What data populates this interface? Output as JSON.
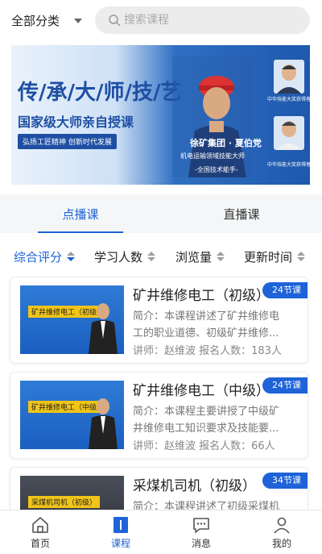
{
  "header": {
    "category_label": "全部分类",
    "search_placeholder": "搜索课程"
  },
  "banner": {
    "title": "传/承/大/师/技/艺",
    "subtitle": "国家级大师亲自授课",
    "tag": "弘扬工匠精神 创新时代发展",
    "name": "徐矿集团 · 夏伯党",
    "role": "机电运输领域技能大师",
    "honor": "-全国技术能手-",
    "portrait1_caption": "中华技能大奖获得者",
    "portrait2_caption": "中华技能大奖获得者"
  },
  "tabs": [
    {
      "label": "点播课",
      "active": true
    },
    {
      "label": "直播课",
      "active": false
    }
  ],
  "sort": [
    {
      "label": "综合评分",
      "active": true
    },
    {
      "label": "学习人数",
      "active": false
    },
    {
      "label": "浏览量",
      "active": false
    },
    {
      "label": "更新时间",
      "active": false
    }
  ],
  "courses": [
    {
      "title": "矿井维修电工（初级）",
      "thumb_text": "矿井维修电工（初级）",
      "desc": "简介：本课程讲述了矿井维修电工的职业道德、初级矿井维修...",
      "meta": "讲师：赵维波 报名人数：183人",
      "badge": "24节课"
    },
    {
      "title": "矿井维修电工（中级）",
      "thumb_text": "矿井维修电工（中级）",
      "desc": "简介：本课程主要讲授了中级矿井维修电工知识要求及技能要...",
      "meta": "讲师：赵维波 报名人数：66人",
      "badge": "24节课"
    },
    {
      "title": "采煤机司机（初级）",
      "thumb_text": "采煤机司机（初级）",
      "desc": "简介：本课程讲述了初级采煤机",
      "meta": "",
      "badge": "34节课"
    }
  ],
  "bottom_nav": [
    {
      "label": "首页",
      "icon": "home-icon",
      "active": false
    },
    {
      "label": "课程",
      "icon": "course-icon",
      "active": true
    },
    {
      "label": "消息",
      "icon": "message-icon",
      "active": false
    },
    {
      "label": "我的",
      "icon": "profile-icon",
      "active": false
    }
  ],
  "colors": {
    "accent": "#1e63d8",
    "banner_text": "#1e4fa3"
  }
}
